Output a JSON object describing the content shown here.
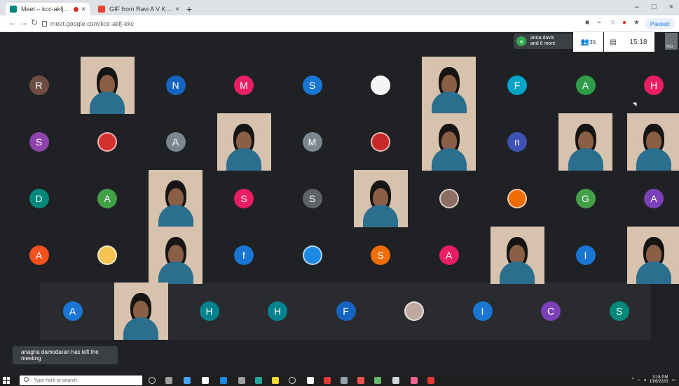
{
  "browser": {
    "tabs": [
      {
        "title": "Meet – kcc-akfj-ekc",
        "favicon": "meet-icon"
      },
      {
        "title": "GIF from Ravi A V Kumar - jessi",
        "favicon": "gmail-icon"
      }
    ],
    "url": "meet.google.com/kcc-akfj-ekc",
    "paused_label": "Paused",
    "window_controls": [
      "–",
      "□",
      "×"
    ]
  },
  "meet": {
    "people_chip": {
      "avatar_letter": "a",
      "line1": "anna davis",
      "line2": "and 8 more"
    },
    "participant_count": "35",
    "time": "15:18",
    "self_label": "You",
    "toast": "anagha damodaran has left the meeting"
  },
  "grid": {
    "rows": [
      [
        {
          "kind": "avatar",
          "letter": "R",
          "color": "#6d4c41"
        },
        {
          "kind": "video",
          "name": "video-participant-1"
        },
        {
          "kind": "avatar",
          "letter": "N",
          "color": "#1565c0"
        },
        {
          "kind": "avatar",
          "letter": "M",
          "color": "#e91e63"
        },
        {
          "kind": "avatar",
          "letter": "S",
          "color": "#1976d2"
        },
        {
          "kind": "photo",
          "name": "profile-photo-1",
          "color": "#f5f5f5"
        },
        {
          "kind": "video",
          "name": "video-participant-2"
        },
        {
          "kind": "avatar",
          "letter": "F",
          "color": "#00a4c8"
        },
        {
          "kind": "avatar",
          "letter": "A",
          "color": "#2e9c48"
        },
        {
          "kind": "avatar",
          "letter": "H",
          "color": "#e91e63"
        }
      ],
      [
        {
          "kind": "avatar",
          "letter": "S",
          "color": "#8e44ad"
        },
        {
          "kind": "photo",
          "name": "profile-photo-2",
          "color": "#d32f2f"
        },
        {
          "kind": "avatar",
          "letter": "A",
          "color": "#7a8791"
        },
        {
          "kind": "video",
          "name": "video-participant-3"
        },
        {
          "kind": "avatar",
          "letter": "M",
          "color": "#7a8791"
        },
        {
          "kind": "photo",
          "name": "profile-photo-3",
          "color": "#c62828"
        },
        {
          "kind": "video",
          "name": "video-participant-4"
        },
        {
          "kind": "avatar",
          "letter": "n",
          "color": "#3f51b5"
        },
        {
          "kind": "video",
          "name": "video-participant-5"
        },
        {
          "kind": "video",
          "name": "video-participant-6"
        }
      ],
      [
        {
          "kind": "avatar",
          "letter": "D",
          "color": "#00897b"
        },
        {
          "kind": "avatar",
          "letter": "A",
          "color": "#43a047"
        },
        {
          "kind": "video",
          "name": "video-participant-7"
        },
        {
          "kind": "avatar",
          "letter": "S",
          "color": "#e91e63"
        },
        {
          "kind": "avatar",
          "letter": "S",
          "color": "#5f6368"
        },
        {
          "kind": "video",
          "name": "video-participant-8"
        },
        {
          "kind": "photo",
          "name": "profile-photo-4",
          "color": "#8d6e63"
        },
        {
          "kind": "photo",
          "name": "profile-photo-5",
          "color": "#ef6c00"
        },
        {
          "kind": "avatar",
          "letter": "G",
          "color": "#43a047"
        },
        {
          "kind": "avatar",
          "letter": "A",
          "color": "#7b3fb8"
        }
      ],
      [
        {
          "kind": "avatar",
          "letter": "A",
          "color": "#f4511e"
        },
        {
          "kind": "photo",
          "name": "profile-photo-6",
          "color": "#f6c453"
        },
        {
          "kind": "video",
          "name": "video-participant-9"
        },
        {
          "kind": "avatar",
          "letter": "f",
          "color": "#1976d2"
        },
        {
          "kind": "photo",
          "name": "profile-photo-7",
          "color": "#1e88e5"
        },
        {
          "kind": "avatar",
          "letter": "S",
          "color": "#ef6c00"
        },
        {
          "kind": "avatar",
          "letter": "A",
          "color": "#e91e63"
        },
        {
          "kind": "video",
          "name": "video-participant-10"
        },
        {
          "kind": "avatar",
          "letter": "I",
          "color": "#1976d2"
        },
        {
          "kind": "video",
          "name": "video-participant-11"
        }
      ],
      [
        {
          "kind": "avatar",
          "letter": "A",
          "color": "#1976d2"
        },
        {
          "kind": "video",
          "name": "video-participant-12"
        },
        {
          "kind": "avatar",
          "letter": "H",
          "color": "#00838f"
        },
        {
          "kind": "avatar",
          "letter": "H",
          "color": "#00838f"
        },
        {
          "kind": "avatar",
          "letter": "F",
          "color": "#1565c0"
        },
        {
          "kind": "photo",
          "name": "profile-photo-8",
          "color": "#bfa8a0"
        },
        {
          "kind": "avatar",
          "letter": "I",
          "color": "#1976d2"
        },
        {
          "kind": "avatar",
          "letter": "C",
          "color": "#7b3fb8"
        },
        {
          "kind": "avatar",
          "letter": "S",
          "color": "#00897b"
        }
      ]
    ]
  },
  "taskbar": {
    "search_placeholder": "Type here to search",
    "time": "3:18 PM",
    "date": "10/6/2020"
  }
}
